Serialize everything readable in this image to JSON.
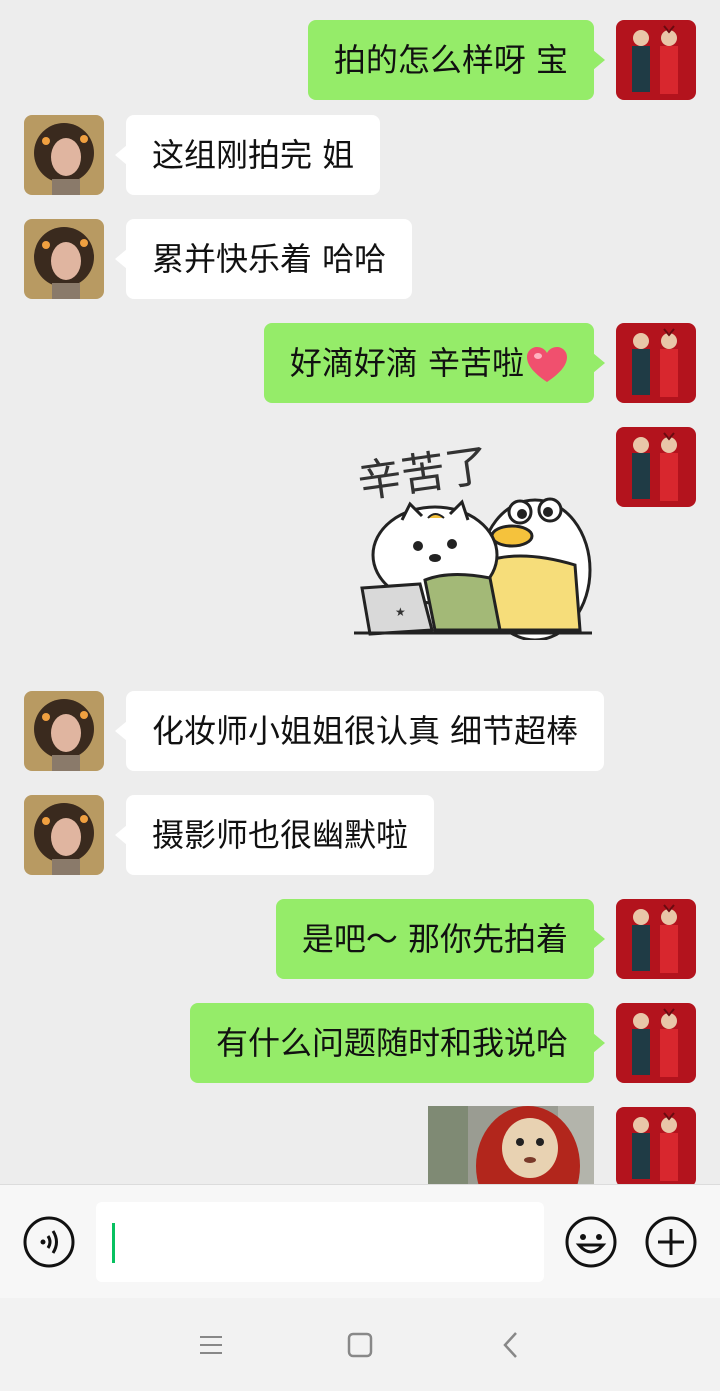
{
  "chat": {
    "messages": [
      {
        "side": "right",
        "text": "拍的怎么样呀 宝"
      },
      {
        "side": "left",
        "text": "这组刚拍完 姐"
      },
      {
        "side": "left",
        "text": "累并快乐着 哈哈"
      },
      {
        "side": "right",
        "text": "好滴好滴 辛苦啦",
        "emoji": "heart-emoji-icon"
      },
      {
        "side": "right",
        "type": "sticker",
        "sticker_text": "辛苦了"
      },
      {
        "side": "left",
        "text": "化妆师小姐姐很认真 细节超棒"
      },
      {
        "side": "left",
        "text": "摄影师也很幽默啦"
      },
      {
        "side": "right",
        "text": "是吧～ 那你先拍着"
      },
      {
        "side": "right",
        "text": "有什么问题随时和我说哈"
      },
      {
        "side": "right",
        "type": "image",
        "image": "teletubby-photo"
      }
    ]
  },
  "input_bar": {
    "voice_icon": "voice-input-icon",
    "emoji_icon": "emoji-smiley-icon",
    "plus_icon": "plus-icon",
    "input_value": ""
  },
  "nav_bar": {
    "icons": [
      "menu-icon",
      "home-square-icon",
      "back-chevron-icon"
    ]
  },
  "colors": {
    "chat_background": "#ededed",
    "sent_bubble": "#95ec69",
    "received_bubble": "#ffffff",
    "cursor": "#07c160",
    "heart": "#f0506e"
  }
}
